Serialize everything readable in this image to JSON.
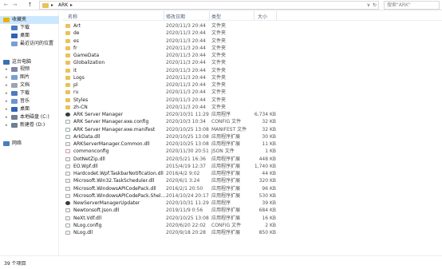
{
  "address": {
    "back": "←",
    "forward": "→",
    "up": "↑",
    "path": [
      "ARK"
    ],
    "search_placeholder": "搜索\"ARK\"",
    "dropdown": "∨",
    "refresh": "↻"
  },
  "columns": {
    "name": "名称",
    "date": "修改日期",
    "type": "类型",
    "size": "大小"
  },
  "sidebar": {
    "items": [
      {
        "label": "收藏夹",
        "icon": "star-icon",
        "color": "#e8b200",
        "indent": 0
      },
      {
        "label": "下载",
        "icon": "download-icon",
        "color": "#4a7dc1",
        "indent": 1
      },
      {
        "label": "桌面",
        "icon": "desktop-icon",
        "color": "#2e64b8",
        "indent": 1
      },
      {
        "label": "最近访问的位置",
        "icon": "recent-icon",
        "color": "#7aa0cf",
        "indent": 1
      },
      {
        "label": "这台电脑",
        "icon": "computer-icon",
        "color": "#3a6fb5",
        "indent": 0
      },
      {
        "label": "视频",
        "icon": "video-icon",
        "color": "#7a86a8",
        "indent": 1
      },
      {
        "label": "图片",
        "icon": "pictures-icon",
        "color": "#7aa0cf",
        "indent": 1
      },
      {
        "label": "文档",
        "icon": "documents-icon",
        "color": "#9aa4b6",
        "indent": 1
      },
      {
        "label": "下载",
        "icon": "download-icon",
        "color": "#4a7dc1",
        "indent": 1
      },
      {
        "label": "音乐",
        "icon": "music-icon",
        "color": "#6a95d2",
        "indent": 1
      },
      {
        "label": "桌面",
        "icon": "desktop-icon",
        "color": "#2e64b8",
        "indent": 1
      },
      {
        "label": "本地磁盘 (C:)",
        "icon": "drive-icon",
        "color": "#6d7f95",
        "indent": 1
      },
      {
        "label": "新建卷 (D:)",
        "icon": "drive-icon",
        "color": "#6d7f95",
        "indent": 1
      },
      {
        "label": "网络",
        "icon": "network-icon",
        "color": "#4a7dc1",
        "indent": 0
      }
    ]
  },
  "files": [
    {
      "name": "Art",
      "date": "2020/11/3 20:44",
      "type": "文件夹",
      "size": "",
      "kind": "folder"
    },
    {
      "name": "de",
      "date": "2020/11/3 20:44",
      "type": "文件夹",
      "size": "",
      "kind": "folder"
    },
    {
      "name": "es",
      "date": "2020/11/3 20:44",
      "type": "文件夹",
      "size": "",
      "kind": "folder"
    },
    {
      "name": "fr",
      "date": "2020/11/3 20:44",
      "type": "文件夹",
      "size": "",
      "kind": "folder"
    },
    {
      "name": "GameData",
      "date": "2020/11/3 20:44",
      "type": "文件夹",
      "size": "",
      "kind": "folder"
    },
    {
      "name": "Globalization",
      "date": "2020/11/3 20:44",
      "type": "文件夹",
      "size": "",
      "kind": "folder"
    },
    {
      "name": "it",
      "date": "2020/11/3 20:44",
      "type": "文件夹",
      "size": "",
      "kind": "folder"
    },
    {
      "name": "Logs",
      "date": "2020/11/3 20:44",
      "type": "文件夹",
      "size": "",
      "kind": "folder"
    },
    {
      "name": "pl",
      "date": "2020/11/3 20:44",
      "type": "文件夹",
      "size": "",
      "kind": "folder"
    },
    {
      "name": "ru",
      "date": "2020/11/3 20:44",
      "type": "文件夹",
      "size": "",
      "kind": "folder"
    },
    {
      "name": "Styles",
      "date": "2020/11/3 20:44",
      "type": "文件夹",
      "size": "",
      "kind": "folder"
    },
    {
      "name": "zh-CN",
      "date": "2020/11/3 20:44",
      "type": "文件夹",
      "size": "",
      "kind": "folder"
    },
    {
      "name": "ARK Server Manager",
      "date": "2020/10/31 11:29",
      "type": "应用程序",
      "size": "6,734 KB",
      "kind": "exe"
    },
    {
      "name": "ARK Server Manager.exe.config",
      "date": "2020/10/3 10:34",
      "type": "CONFIG 文件",
      "size": "32 KB",
      "kind": "cfg"
    },
    {
      "name": "ARK Server Manager.exe.manifest",
      "date": "2020/10/25 13:08",
      "type": "MANIFEST 文件",
      "size": "32 KB",
      "kind": "cfg"
    },
    {
      "name": "ArkData.dll",
      "date": "2020/10/25 13:08",
      "type": "应用程序扩展",
      "size": "30 KB",
      "kind": "dll"
    },
    {
      "name": "ARKServerManager.Common.dll",
      "date": "2020/10/25 13:08",
      "type": "应用程序扩展",
      "size": "11 KB",
      "kind": "dll"
    },
    {
      "name": "commonconfig",
      "date": "2020/11/30 20:51",
      "type": "JSON 文件",
      "size": "1 KB",
      "kind": "json"
    },
    {
      "name": "DotNetZip.dll",
      "date": "2020/5/21 16:36",
      "type": "应用程序扩展",
      "size": "448 KB",
      "kind": "dll"
    },
    {
      "name": "EO.Wpf.dll",
      "date": "2015/4/19 12:37",
      "type": "应用程序扩展",
      "size": "1,740 KB",
      "kind": "dll"
    },
    {
      "name": "Hardcodet.Wpf.TaskbarNotification.dll",
      "date": "2016/4/2 9:02",
      "type": "应用程序扩展",
      "size": "44 KB",
      "kind": "dll"
    },
    {
      "name": "Microsoft.Win32.TaskScheduler.dll",
      "date": "2020/6/1 3:24",
      "type": "应用程序扩展",
      "size": "320 KB",
      "kind": "dll"
    },
    {
      "name": "Microsoft.WindowsAPICodePack.dll",
      "date": "2016/2/1 20:50",
      "type": "应用程序扩展",
      "size": "96 KB",
      "kind": "dll"
    },
    {
      "name": "Microsoft.WindowsAPICodePack.Shel...",
      "date": "2014/10/24 20:17",
      "type": "应用程序扩展",
      "size": "530 KB",
      "kind": "dll"
    },
    {
      "name": "NewServerManagerUpdater",
      "date": "2020/10/31 11:29",
      "type": "应用程序",
      "size": "39 KB",
      "kind": "exe"
    },
    {
      "name": "Newtonsoft.Json.dll",
      "date": "2019/11/9 0:56",
      "type": "应用程序扩展",
      "size": "684 KB",
      "kind": "dll"
    },
    {
      "name": "NeXt.Vdf.dll",
      "date": "2020/10/25 13:08",
      "type": "应用程序扩展",
      "size": "16 KB",
      "kind": "dll"
    },
    {
      "name": "NLog.config",
      "date": "2020/6/20 22:02",
      "type": "CONFIG 文件",
      "size": "2 KB",
      "kind": "cfg"
    },
    {
      "name": "NLog.dll",
      "date": "2020/9/18 20:28",
      "type": "应用程序扩展",
      "size": "850 KB",
      "kind": "dll"
    }
  ],
  "status": {
    "count": "39 个项目"
  }
}
